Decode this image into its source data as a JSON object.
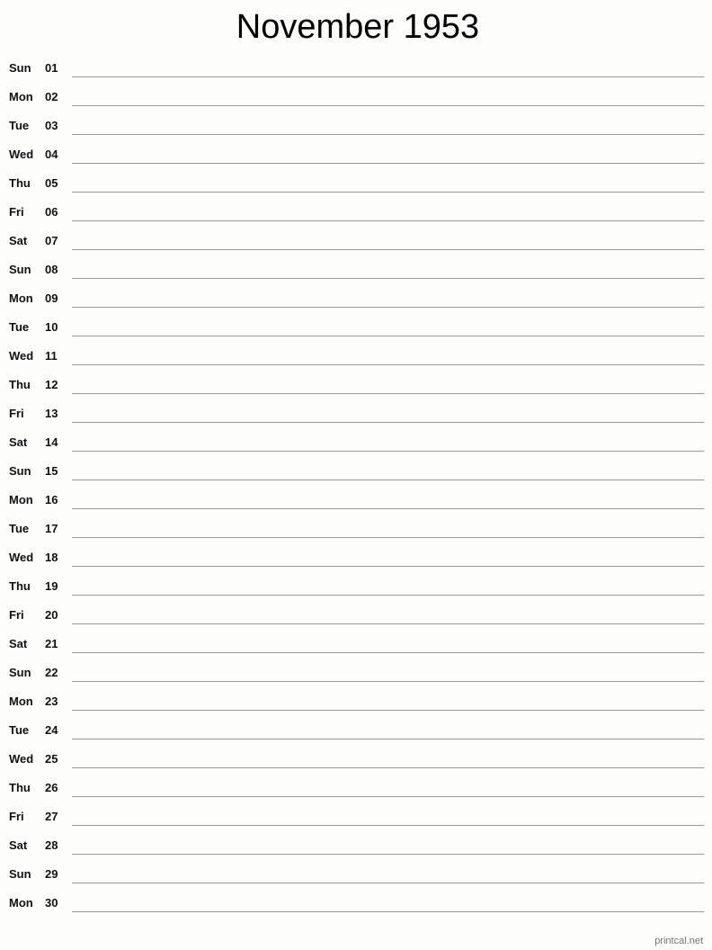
{
  "title": "November 1953",
  "days": [
    {
      "day": "Sun",
      "num": "01"
    },
    {
      "day": "Mon",
      "num": "02"
    },
    {
      "day": "Tue",
      "num": "03"
    },
    {
      "day": "Wed",
      "num": "04"
    },
    {
      "day": "Thu",
      "num": "05"
    },
    {
      "day": "Fri",
      "num": "06"
    },
    {
      "day": "Sat",
      "num": "07"
    },
    {
      "day": "Sun",
      "num": "08"
    },
    {
      "day": "Mon",
      "num": "09"
    },
    {
      "day": "Tue",
      "num": "10"
    },
    {
      "day": "Wed",
      "num": "11"
    },
    {
      "day": "Thu",
      "num": "12"
    },
    {
      "day": "Fri",
      "num": "13"
    },
    {
      "day": "Sat",
      "num": "14"
    },
    {
      "day": "Sun",
      "num": "15"
    },
    {
      "day": "Mon",
      "num": "16"
    },
    {
      "day": "Tue",
      "num": "17"
    },
    {
      "day": "Wed",
      "num": "18"
    },
    {
      "day": "Thu",
      "num": "19"
    },
    {
      "day": "Fri",
      "num": "20"
    },
    {
      "day": "Sat",
      "num": "21"
    },
    {
      "day": "Sun",
      "num": "22"
    },
    {
      "day": "Mon",
      "num": "23"
    },
    {
      "day": "Tue",
      "num": "24"
    },
    {
      "day": "Wed",
      "num": "25"
    },
    {
      "day": "Thu",
      "num": "26"
    },
    {
      "day": "Fri",
      "num": "27"
    },
    {
      "day": "Sat",
      "num": "28"
    },
    {
      "day": "Sun",
      "num": "29"
    },
    {
      "day": "Mon",
      "num": "30"
    }
  ],
  "footer": "printcal.net"
}
